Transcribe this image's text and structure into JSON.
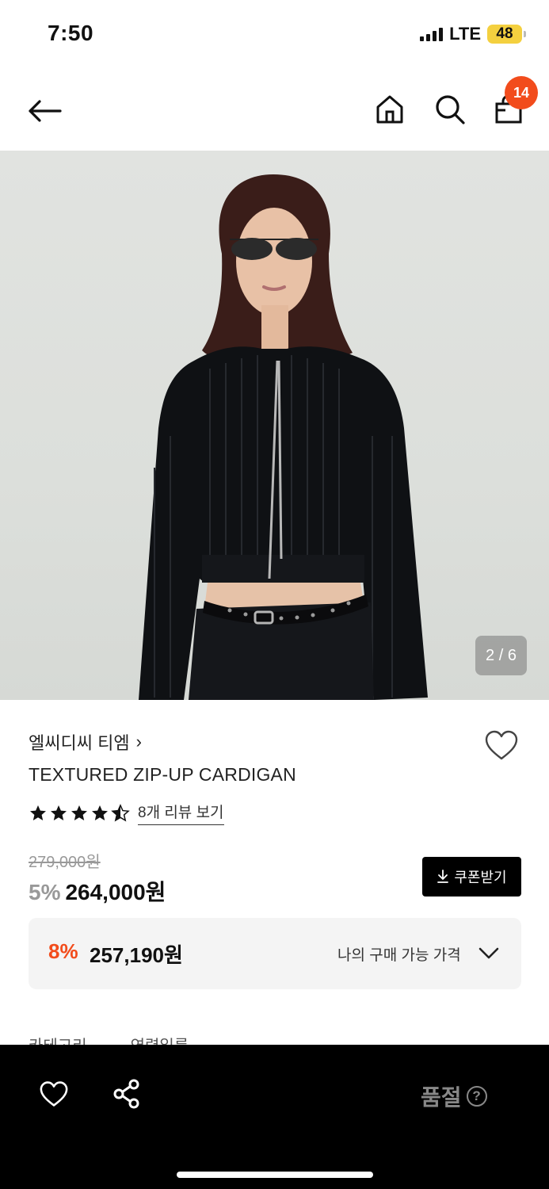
{
  "status": {
    "time": "7:50",
    "network": "LTE",
    "battery": "48"
  },
  "header": {
    "cart_count": "14"
  },
  "gallery": {
    "indicator": "2 / 6"
  },
  "product": {
    "brand": "엘씨디씨 티엠",
    "brand_chevron": "›",
    "name": "TEXTURED ZIP-UP CARDIGAN",
    "rating": 4.5,
    "review_link": "8개 리뷰 보기",
    "original_price": "279,000원",
    "discount_rate": "5%",
    "sale_price": "264,000원",
    "coupon_label": "쿠폰받기"
  },
  "my_price": {
    "rate": "8%",
    "value": "257,190원",
    "label": "나의 구매 가능 가격"
  },
  "details": {
    "tabs": [
      "카테고리",
      "연령일름"
    ]
  },
  "bottom_bar": {
    "status_label": "품절",
    "help_icon": "?"
  },
  "colors": {
    "accent": "#f24c1c",
    "badge": "#f24c1c",
    "bottom_bar": "#000000",
    "muted": "#999999"
  }
}
